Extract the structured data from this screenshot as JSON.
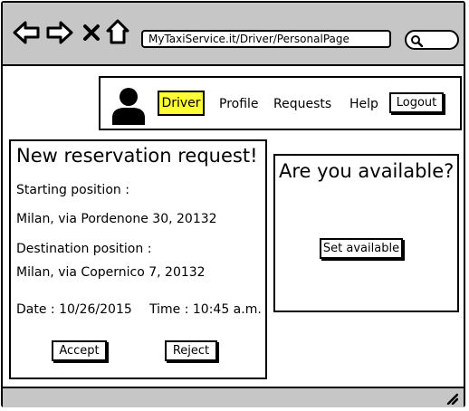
{
  "browser": {
    "url": "MyTaxiService.it/Driver/PersonalPage",
    "icons": [
      "back-arrow-icon",
      "forward-arrow-icon",
      "close-icon",
      "home-icon",
      "search-icon"
    ]
  },
  "nav": {
    "driver": "Driver",
    "profile": "Profile",
    "requests": "Requests",
    "help": "Help",
    "logout": "Logout"
  },
  "reservation": {
    "title": "New reservation request!",
    "start_label": "Starting position :",
    "start_value": "Milan, via Pordenone 30, 20132",
    "dest_label": "Destination position :",
    "dest_value": "Milan, via Copernico 7, 20132",
    "date": "Date : 10/26/2015",
    "time": "Time : 10:45 a.m.",
    "accept": "Accept",
    "reject": "Reject"
  },
  "availability": {
    "title": "Are you available?",
    "button": "Set available"
  },
  "colors": {
    "chrome": "#c6c6c6",
    "highlight": "#ffff33"
  }
}
